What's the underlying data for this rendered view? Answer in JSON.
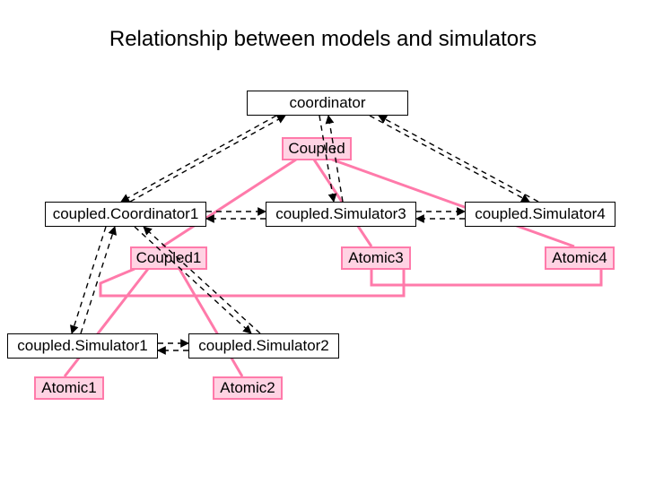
{
  "title": "Relationship between models and simulators",
  "nodes": {
    "coordinator": "coordinator",
    "coupled": "Coupled",
    "coupledCoordinator1": "coupled.Coordinator1",
    "coupledSimulator3": "coupled.Simulator3",
    "coupledSimulator4": "coupled.Simulator4",
    "coupled1": "Coupled1",
    "atomic3": "Atomic3",
    "atomic4": "Atomic4",
    "coupledSimulator1": "coupled.Simulator1",
    "coupledSimulator2": "coupled.Simulator2",
    "atomic1": "Atomic1",
    "atomic2": "Atomic2"
  },
  "chart_data": {
    "type": "diagram",
    "title": "Relationship between models and simulators",
    "nodes": [
      {
        "id": "coordinator",
        "label": "coordinator",
        "kind": "simulator"
      },
      {
        "id": "Coupled",
        "label": "Coupled",
        "kind": "model-coupled"
      },
      {
        "id": "coupledCoordinator1",
        "label": "coupled.Coordinator1",
        "kind": "simulator"
      },
      {
        "id": "coupledSimulator3",
        "label": "coupled.Simulator3",
        "kind": "simulator"
      },
      {
        "id": "coupledSimulator4",
        "label": "coupled.Simulator4",
        "kind": "simulator"
      },
      {
        "id": "Coupled1",
        "label": "Coupled1",
        "kind": "model-coupled"
      },
      {
        "id": "Atomic3",
        "label": "Atomic3",
        "kind": "model-atomic"
      },
      {
        "id": "Atomic4",
        "label": "Atomic4",
        "kind": "model-atomic"
      },
      {
        "id": "coupledSimulator1",
        "label": "coupled.Simulator1",
        "kind": "simulator"
      },
      {
        "id": "coupledSimulator2",
        "label": "coupled.Simulator2",
        "kind": "simulator"
      },
      {
        "id": "Atomic1",
        "label": "Atomic1",
        "kind": "model-atomic"
      },
      {
        "id": "Atomic2",
        "label": "Atomic2",
        "kind": "model-atomic"
      }
    ],
    "edges_hierarchy_dashed_bidirectional": [
      [
        "coordinator",
        "coupledCoordinator1"
      ],
      [
        "coordinator",
        "coupledSimulator3"
      ],
      [
        "coordinator",
        "coupledSimulator4"
      ],
      [
        "coupledCoordinator1",
        "coupledSimulator3"
      ],
      [
        "coupledSimulator3",
        "coupledSimulator4"
      ],
      [
        "coupledCoordinator1",
        "coupledSimulator1"
      ],
      [
        "coupledCoordinator1",
        "coupledSimulator2"
      ],
      [
        "coupledSimulator1",
        "coupledSimulator2"
      ]
    ],
    "edges_model_containment_pink": [
      [
        "Coupled",
        "Coupled1"
      ],
      [
        "Coupled",
        "Atomic3"
      ],
      [
        "Coupled",
        "Atomic4"
      ],
      [
        "Coupled1",
        "Atomic1"
      ],
      [
        "Coupled1",
        "Atomic2"
      ],
      [
        "Coupled1",
        "Atomic3"
      ],
      [
        "Atomic3",
        "Atomic4"
      ]
    ],
    "colors": {
      "atomic_fill": "#ffd3e3",
      "atomic_border": "#ff7aaa",
      "link_pink": "#ff7aaa"
    }
  }
}
